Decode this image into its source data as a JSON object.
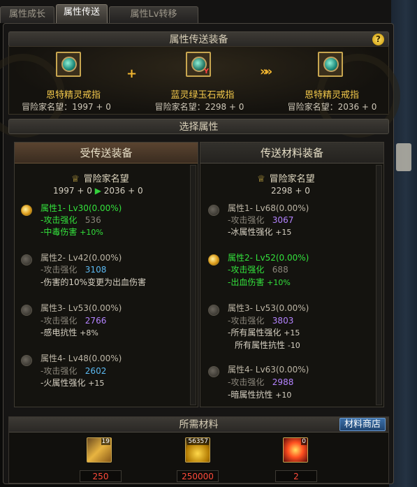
{
  "tabs": [
    {
      "label": "属性成长"
    },
    {
      "label": "属性传送"
    },
    {
      "label": "属性Lv转移"
    }
  ],
  "header": {
    "title": "属性传送装备",
    "help": "?"
  },
  "transfer": {
    "result": {
      "name": "恩特精灵戒指",
      "fame": "冒险家名望：1997 + 0"
    },
    "material": {
      "name": "蓝灵绿玉石戒指",
      "fame": "冒险家名望：2298 + 0",
      "tag": "Y"
    },
    "after": {
      "name": "恩特精灵戒指",
      "fame": "冒险家名望：2036 + 0"
    },
    "plus": "+",
    "arrows": "»»"
  },
  "select": {
    "title": "选择属性"
  },
  "left": {
    "title": "受传送装备",
    "crest": "冒险家名望",
    "fame_from": "1997 + 0",
    "fame_to": "2036 + 0",
    "attrs": [
      {
        "name": "属性1- Lv30(0.00%)",
        "l1": "-攻击强化",
        "v1": "536",
        "l2": "-中毒伤害",
        "v2": "+10%",
        "selected": true
      },
      {
        "name": "属性2- Lv42(0.00%)",
        "l1": "-攻击强化",
        "v1": "3108",
        "l2": "-伤害的10%变更为出血伤害",
        "v2": "",
        "selected": false
      },
      {
        "name": "属性3- Lv53(0.00%)",
        "l1": "-攻击强化",
        "v1": "2766",
        "l2": "-感电抗性",
        "v2": "+8%",
        "selected": false
      },
      {
        "name": "属性4- Lv48(0.00%)",
        "l1": "-攻击强化",
        "v1": "2602",
        "l2": "-火属性强化",
        "v2": "+15",
        "selected": false
      }
    ]
  },
  "right": {
    "title": "传送材料装备",
    "crest": "冒险家名望",
    "fame": "2298 + 0",
    "attrs": [
      {
        "name": "属性1- Lv68(0.00%)",
        "l1": "-攻击强化",
        "v1": "3067",
        "l2": "-冰属性强化",
        "v2": "+15",
        "selected": false
      },
      {
        "name": "属性2- Lv52(0.00%)",
        "l1": "-攻击强化",
        "v1": "688",
        "l2": "-出血伤害",
        "v2": "+10%",
        "selected": true
      },
      {
        "name": "属性3- Lv53(0.00%)",
        "l1": "-攻击强化",
        "v1": "3803",
        "l2": "-所有属性强化",
        "v2": "+15",
        "l3": "所有属性抗性",
        "v3": "-10",
        "selected": false
      },
      {
        "name": "属性4- Lv63(0.00%)",
        "l1": "-攻击强化",
        "v1": "2988",
        "l2": "-暗属性抗性",
        "v2": "+10",
        "selected": false
      }
    ]
  },
  "materials": {
    "title": "所需材料",
    "shop": "材料商店",
    "items": [
      {
        "count": "19",
        "required": "250",
        "icon": "gold-bar-icon"
      },
      {
        "count": "56357",
        "required": "250000",
        "icon": "gold-coins-icon"
      },
      {
        "count": "0",
        "required": "2",
        "icon": "red-crystal-icon"
      }
    ]
  }
}
